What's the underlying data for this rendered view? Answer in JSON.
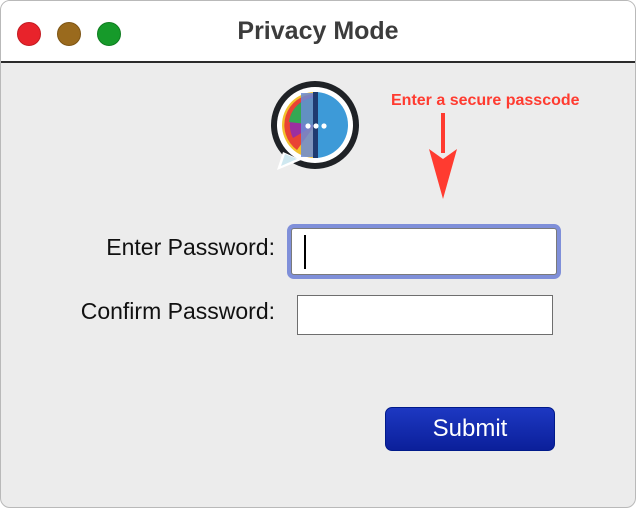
{
  "window": {
    "title": "Privacy Mode"
  },
  "annotation": {
    "text": "Enter a secure passcode",
    "color": "#ff3b30"
  },
  "form": {
    "password_label": "Enter Password:",
    "password_value": "",
    "confirm_label": "Confirm Password:",
    "confirm_value": "",
    "submit_label": "Submit"
  },
  "colors": {
    "submit_button": "#0b1f9a",
    "focus_ring": "#7f8fd9",
    "close": "#e8232b",
    "minimize": "#9a6a1d",
    "maximize": "#169a2a"
  },
  "icons": {
    "logo": "chat-bubble-logo-icon",
    "arrow": "red-arrow-down-icon"
  }
}
